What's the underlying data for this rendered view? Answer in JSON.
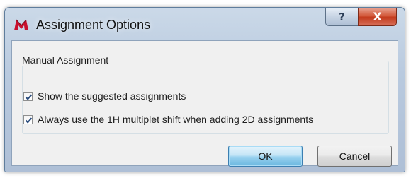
{
  "window": {
    "title": "Assignment Options",
    "help_label": "?",
    "close_label": "X"
  },
  "group": {
    "label": "Manual Assignment",
    "options": [
      {
        "label": "Show the suggested assignments",
        "checked": true
      },
      {
        "label": "Always use the 1H multiplet shift when adding 2D assignments",
        "checked": true
      }
    ]
  },
  "buttons": {
    "ok_label": "OK",
    "cancel_label": "Cancel"
  },
  "colors": {
    "close_button": "#c23a1c",
    "ok_button": "#98d1ef",
    "app_icon": "#c8102e"
  },
  "icons": {
    "app": "app-logo-icon",
    "help": "help-icon",
    "close": "close-icon",
    "check": "checkmark-icon"
  }
}
